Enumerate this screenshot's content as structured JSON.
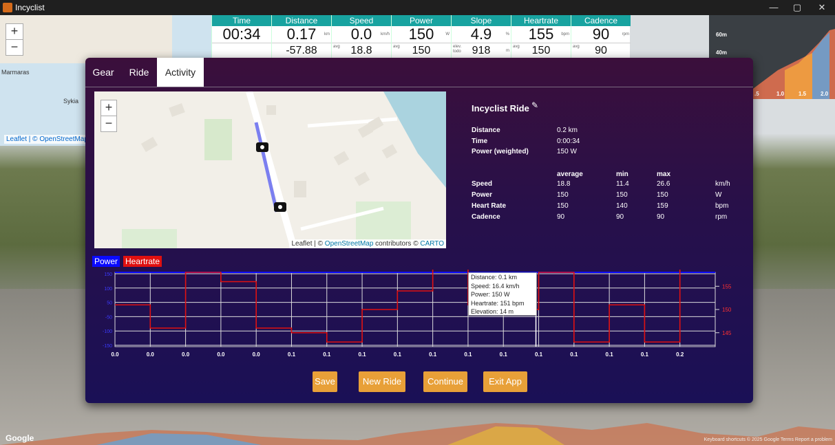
{
  "window": {
    "title": "Incyclist",
    "controls": [
      "—",
      "▢",
      "✕"
    ]
  },
  "map_overview": {
    "zoom_in": "+",
    "zoom_out": "−",
    "labels": [
      "Marmaras",
      "Sykia"
    ],
    "attribution": "Leaflet | © OpenStreetMap"
  },
  "hud": [
    {
      "label": "Time",
      "value": "00:34",
      "unit": "",
      "sub_label": "",
      "sub_value": ""
    },
    {
      "label": "Distance",
      "value": "0.17",
      "unit": "km",
      "sub_label": "",
      "sub_value": "-57.88"
    },
    {
      "label": "Speed",
      "value": "0.0",
      "unit": "km/h",
      "sub_label": "avg",
      "sub_value": "18.8"
    },
    {
      "label": "Power",
      "value": "150",
      "unit": "W",
      "sub_label": "avg",
      "sub_value": "150"
    },
    {
      "label": "Slope",
      "value": "4.9",
      "unit": "%",
      "sub_label": "elev. todo",
      "sub_value": "918",
      "sub_unit": "m"
    },
    {
      "label": "Heartrate",
      "value": "155",
      "unit": "bpm",
      "sub_label": "avg",
      "sub_value": "150"
    },
    {
      "label": "Cadence",
      "value": "90",
      "unit": "rpm",
      "sub_label": "avg",
      "sub_value": "90"
    }
  ],
  "elevation_profile": {
    "y_labels": [
      "60m",
      "40m"
    ],
    "x_labels": [
      ".5",
      "1.0",
      "1.5",
      "2.0"
    ]
  },
  "tabs": [
    {
      "label": "Gear",
      "active": false
    },
    {
      "label": "Ride",
      "active": false
    },
    {
      "label": "Activity",
      "active": true
    }
  ],
  "activity_map": {
    "zoom_in": "+",
    "zoom_out": "−",
    "attribution_prefix": "Leaflet | © ",
    "attribution_link": "OpenStreetMap",
    "attribution_suffix": " contributors © ",
    "attribution_carto": "CARTO"
  },
  "summary": {
    "title": "Incyclist Ride",
    "rows": [
      {
        "label": "Distance",
        "value": "0.2 km"
      },
      {
        "label": "Time",
        "value": "0:00:34"
      },
      {
        "label": "Power (weighted)",
        "value": "150 W"
      }
    ],
    "stats_headers": [
      "average",
      "min",
      "max"
    ],
    "stats": [
      {
        "label": "Speed",
        "average": "18.8",
        "min": "11.4",
        "max": "26.6",
        "unit": "km/h"
      },
      {
        "label": "Power",
        "average": "150",
        "min": "150",
        "max": "150",
        "unit": "W"
      },
      {
        "label": "Heart Rate",
        "average": "150",
        "min": "140",
        "max": "159",
        "unit": "bpm"
      },
      {
        "label": "Cadence",
        "average": "90",
        "min": "90",
        "max": "90",
        "unit": "rpm"
      }
    ]
  },
  "chart_legend": {
    "power": {
      "label": "Power",
      "color": "#0a0aff"
    },
    "heartrate": {
      "label": "Heartrate",
      "color": "#e01010"
    }
  },
  "chart_data": {
    "type": "line",
    "categories": [
      "0.0",
      "0.0",
      "0.0",
      "0.0",
      "0.0",
      "0.1",
      "0.1",
      "0.1",
      "0.1",
      "0.1",
      "0.1",
      "0.1",
      "0.1",
      "0.1",
      "0.1",
      "0.1",
      "0.2"
    ],
    "left_axis_ticks": [
      "150",
      "100",
      "50",
      "-50",
      "-100",
      "-150"
    ],
    "right_axis_ticks": [
      "155",
      "150",
      "145"
    ],
    "ylim_right": [
      142,
      158
    ],
    "series": [
      {
        "name": "Power",
        "color": "#0a0aff",
        "values": [
          150,
          150,
          150,
          150,
          150,
          150,
          150,
          150,
          150,
          150,
          150,
          150,
          150,
          150,
          150,
          150,
          150,
          150
        ]
      },
      {
        "name": "Heartrate",
        "color": "#e01010",
        "values": [
          151,
          146,
          158,
          156,
          146,
          145,
          143,
          150,
          154,
          159,
          151,
          150,
          158,
          143,
          151,
          143,
          159,
          159
        ]
      }
    ],
    "cursor_index": 12
  },
  "tooltip": [
    "Distance: 0.1 km",
    "Speed: 16.4 km/h",
    "Power: 150 W",
    "Heartrate: 151 bpm",
    "Elevation: 14 m"
  ],
  "buttons": {
    "save": "Save",
    "new_ride": "New Ride",
    "continue": "Continue",
    "exit": "Exit App"
  },
  "footer": {
    "google": "Google",
    "links": "Keyboard shortcuts   © 2025 Google   Terms   Report a problem"
  }
}
